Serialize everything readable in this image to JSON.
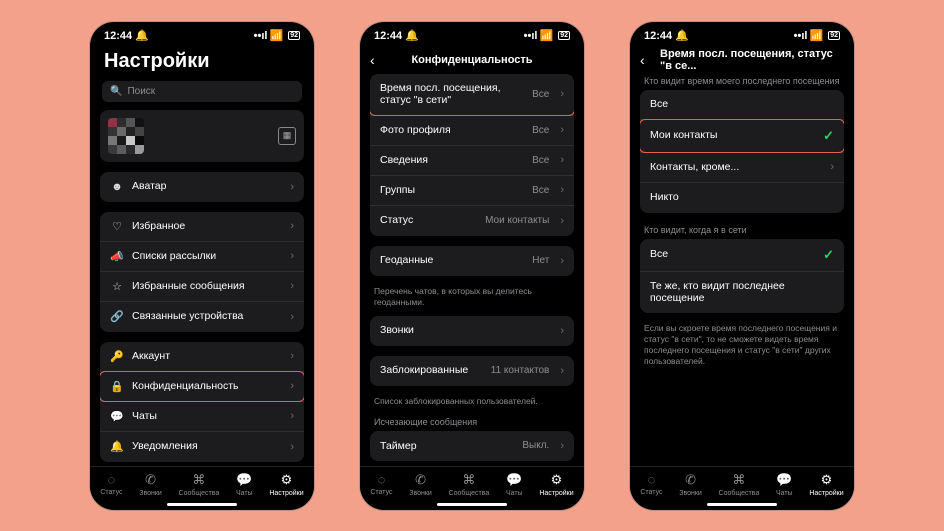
{
  "status": {
    "time": "12:44",
    "bell": "🔔",
    "signal": "••ıl",
    "wifi": "📶",
    "battery": "92"
  },
  "s1": {
    "title": "Настройки",
    "search_placeholder": "Поиск",
    "avatar": "Аватар",
    "group_a": [
      {
        "icon": "♡",
        "label": "Избранное"
      },
      {
        "icon": "📣",
        "label": "Списки рассылки"
      },
      {
        "icon": "☆",
        "label": "Избранные сообщения"
      },
      {
        "icon": "🔗",
        "label": "Связанные устройства"
      }
    ],
    "group_b": [
      {
        "icon": "🔑",
        "label": "Аккаунт"
      },
      {
        "icon": "🔒",
        "label": "Конфиденциальность",
        "hl": true
      },
      {
        "icon": "💬",
        "label": "Чаты"
      },
      {
        "icon": "🔔",
        "label": "Уведомления"
      }
    ]
  },
  "s2": {
    "title": "Конфиденциальность",
    "group_a": [
      {
        "label": "Время посл. посещения, статус \"в сети\"",
        "val": "Все",
        "hl": true
      },
      {
        "label": "Фото профиля",
        "val": "Все"
      },
      {
        "label": "Сведения",
        "val": "Все"
      },
      {
        "label": "Группы",
        "val": "Все"
      },
      {
        "label": "Статус",
        "val": "Мои контакты"
      }
    ],
    "geo_label": "Геоданные",
    "geo_val": "Нет",
    "geo_note": "Перечень чатов, в которых вы делитесь геоданными.",
    "calls_label": "Звонки",
    "blocked_label": "Заблокированные",
    "blocked_val": "11 контактов",
    "blocked_note": "Список заблокированных пользователей.",
    "disappear_header": "Исчезающие сообщения",
    "timer_label": "Таймер",
    "timer_val": "Выкл."
  },
  "s3": {
    "title": "Время посл. посещения, статус \"в се...",
    "section1": "Кто видит время моего последнего посещения",
    "opts1": [
      {
        "label": "Все"
      },
      {
        "label": "Мои контакты",
        "checked": true,
        "hl": true
      },
      {
        "label": "Контакты, кроме...",
        "chev": true
      },
      {
        "label": "Никто"
      }
    ],
    "section2": "Кто видит, когда я в сети",
    "opts2": [
      {
        "label": "Все",
        "checked": true
      },
      {
        "label": "Те же, кто видит последнее посещение"
      }
    ],
    "note": "Если вы скроете время последнего посещения и статус \"в сети\", то не сможете видеть время последнего посещения и статус \"в сети\" других пользователей."
  },
  "tabs": [
    {
      "icon": "◌",
      "label": "Статус"
    },
    {
      "icon": "✆",
      "label": "Звонки"
    },
    {
      "icon": "⌘",
      "label": "Сообщества"
    },
    {
      "icon": "💬",
      "label": "Чаты"
    },
    {
      "icon": "⚙",
      "label": "Настройки",
      "active": true
    }
  ]
}
